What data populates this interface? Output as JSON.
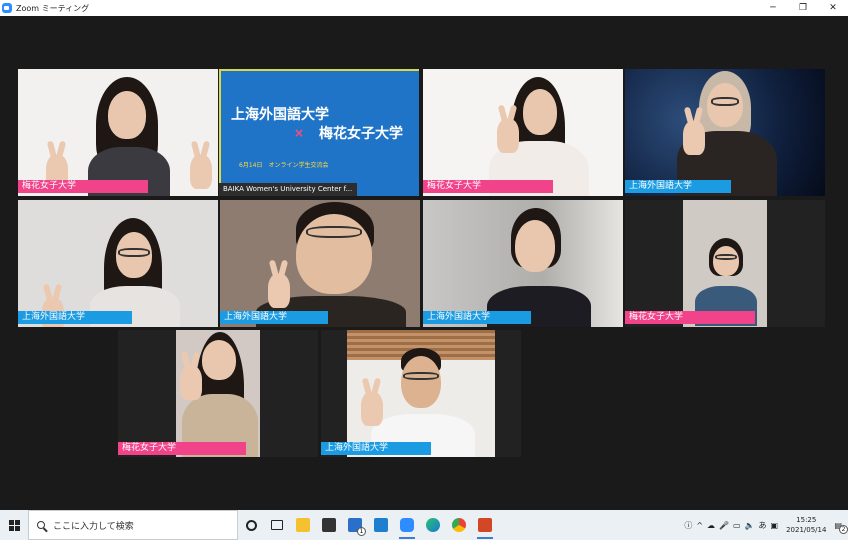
{
  "window": {
    "title": "Zoom ミーティング",
    "minimize": "─",
    "maximize": "❐",
    "close": "✕"
  },
  "participants": [
    {
      "name": "梅花女子大学",
      "tag": "pink"
    },
    {
      "name": "BAIKA Women's University Center f...",
      "tag": "gray",
      "slide": {
        "line1": "上海外国語大学",
        "cross": "×",
        "line2": "梅花女子大学",
        "line3": "6月14日　オンライン学生交流会"
      }
    },
    {
      "name": "梅花女子大学",
      "tag": "pink"
    },
    {
      "name": "上海外国語大学",
      "tag": "blue"
    },
    {
      "name": "上海外国語大学",
      "tag": "blue"
    },
    {
      "name": "上海外国語大学",
      "tag": "blue"
    },
    {
      "name": "上海外国語大学",
      "tag": "blue"
    },
    {
      "name": "梅花女子大学",
      "tag": "pink"
    },
    {
      "name": "梅花女子大学",
      "tag": "pink"
    },
    {
      "name": "上海外国語大学",
      "tag": "blue"
    }
  ],
  "taskbar": {
    "search_placeholder": "ここに入力して検索",
    "mail_badge": "1",
    "ime": "あ",
    "time": "15:25",
    "date": "2021/05/14",
    "notify_badge": "2"
  }
}
